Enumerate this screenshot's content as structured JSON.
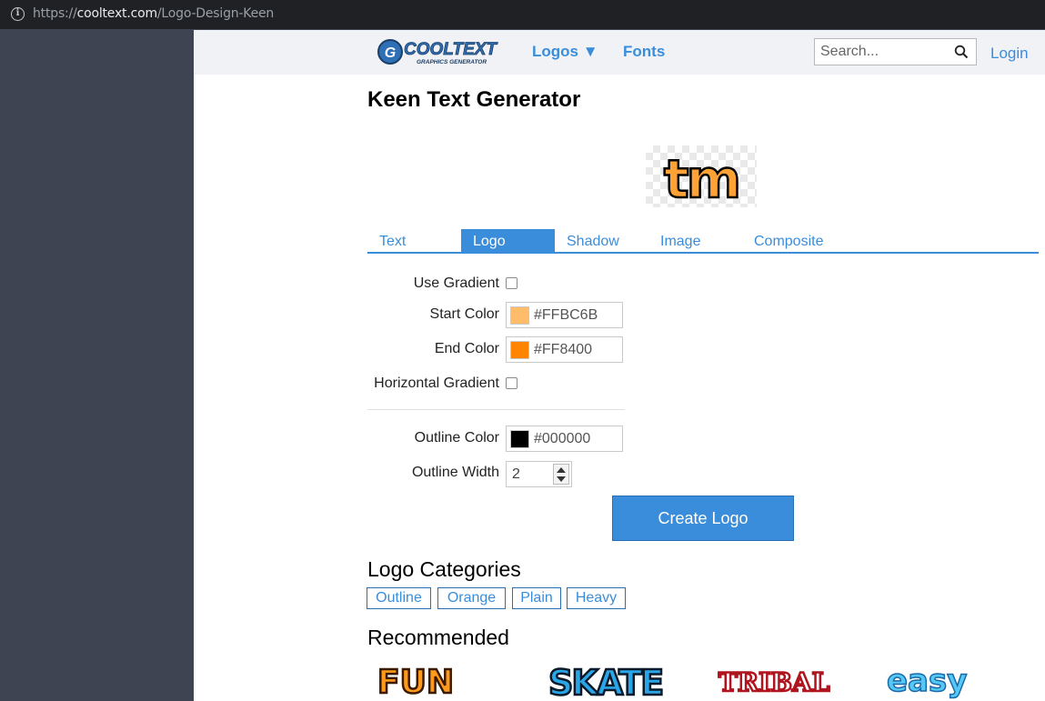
{
  "browser": {
    "url_prefix": "https://",
    "url_domain": "cooltext.com",
    "url_path": "/Logo-Design-Keen"
  },
  "header": {
    "logo_main": "COOLTEXT",
    "logo_sub": "GRAPHICS GENERATOR",
    "nav_logos": "Logos ▼",
    "nav_fonts": "Fonts",
    "search_placeholder": "Search...",
    "login": "Login"
  },
  "page": {
    "title": "Keen Text Generator",
    "preview_text": "tm"
  },
  "tabs": [
    {
      "label": "Text",
      "active": false
    },
    {
      "label": "Logo",
      "active": true
    },
    {
      "label": "Shadow",
      "active": false
    },
    {
      "label": "Image",
      "active": false
    },
    {
      "label": "Composite",
      "active": false
    }
  ],
  "form": {
    "use_gradient_label": "Use Gradient",
    "use_gradient_checked": false,
    "start_color_label": "Start Color",
    "start_color_value": "#FFBC6B",
    "end_color_label": "End Color",
    "end_color_value": "#FF8400",
    "horizontal_gradient_label": "Horizontal Gradient",
    "horizontal_gradient_checked": false,
    "outline_color_label": "Outline Color",
    "outline_color_value": "#000000",
    "outline_width_label": "Outline Width",
    "outline_width_value": "2",
    "create_button": "Create Logo"
  },
  "categories": {
    "heading": "Logo Categories",
    "items": [
      "Outline",
      "Orange",
      "Plain",
      "Heavy"
    ]
  },
  "recommended": {
    "heading": "Recommended",
    "items": [
      "FUN",
      "SKATE",
      "TRIBAL",
      "easy"
    ]
  },
  "colors": {
    "accent": "#3a8ddb",
    "sidebar": "#3f4452",
    "topbar": "#f1f2f5"
  }
}
